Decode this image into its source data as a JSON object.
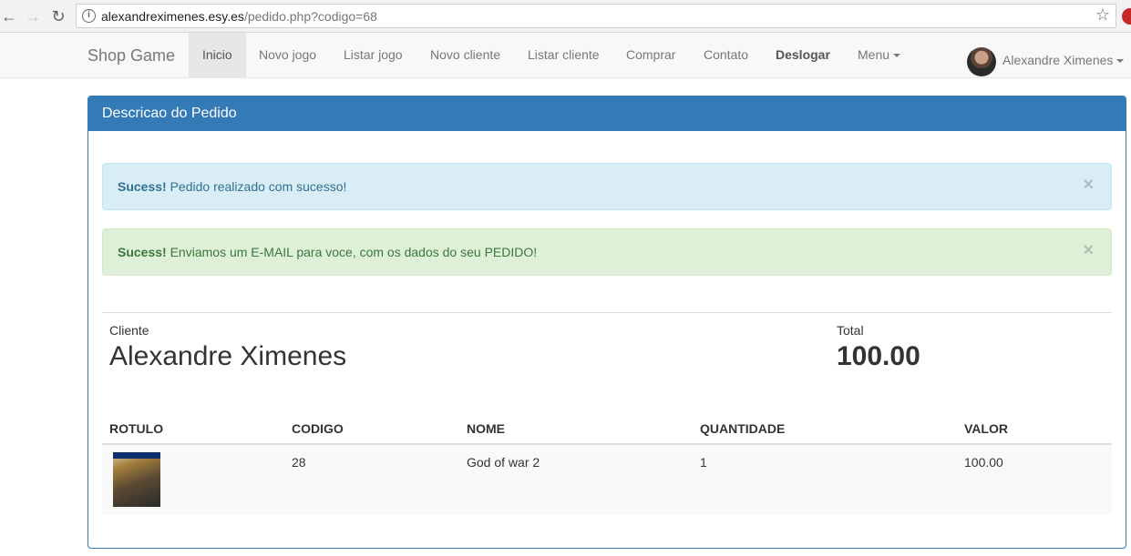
{
  "browser": {
    "url_host": "alexandreximenes.esy.es",
    "url_path": "/pedido.php?codigo=68"
  },
  "navbar": {
    "brand": "Shop Game",
    "items": [
      {
        "label": "Inicio",
        "active": true
      },
      {
        "label": "Novo jogo"
      },
      {
        "label": "Listar jogo"
      },
      {
        "label": "Novo cliente"
      },
      {
        "label": "Listar cliente"
      },
      {
        "label": "Comprar"
      },
      {
        "label": "Contato"
      },
      {
        "label": "Deslogar",
        "bold": true
      },
      {
        "label": "Menu",
        "dropdown": true
      }
    ],
    "user": "Alexandre Ximenes"
  },
  "panel": {
    "title": "Descricao do Pedido",
    "alerts": [
      {
        "type": "info",
        "strong": "Sucess!",
        "text": "Pedido realizado com sucesso!",
        "close": "×"
      },
      {
        "type": "success",
        "strong": "Sucess!",
        "text": "Enviamos um E-MAIL para voce, com os dados do seu PEDIDO!",
        "close": "×"
      }
    ],
    "cliente_label": "Cliente",
    "cliente_name": "Alexandre Ximenes",
    "total_label": "Total",
    "total_value": "100.00"
  },
  "table": {
    "headers": [
      "ROTULO",
      "CODIGO",
      "NOME",
      "QUANTIDADE",
      "VALOR"
    ],
    "rows": [
      {
        "codigo": "28",
        "nome": "God of war 2",
        "quantidade": "1",
        "valor": "100.00"
      }
    ]
  },
  "colors": {
    "primary": "#337ab7",
    "info_bg": "#d9edf7",
    "success_bg": "#dff0d8"
  }
}
